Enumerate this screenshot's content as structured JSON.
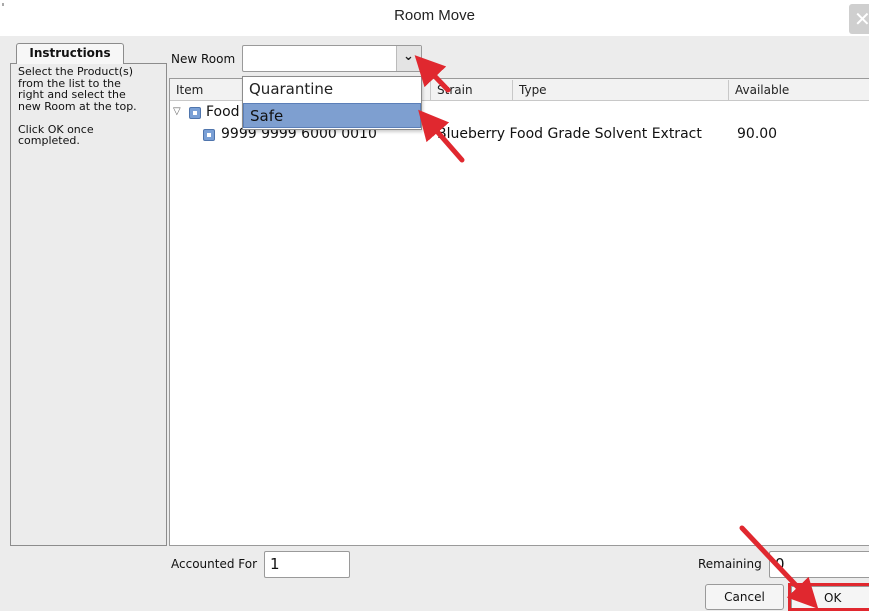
{
  "window": {
    "title": "Room Move"
  },
  "instructions": {
    "tab_label": "Instructions",
    "text": "Select the Product(s)\nfrom the list to the\nright and select the\nnew Room at the top.\n\nClick OK once\ncompleted."
  },
  "new_room": {
    "label": "New Room",
    "value": ""
  },
  "dropdown": {
    "options": [
      "Quarantine",
      "Safe"
    ],
    "highlighted": "Safe"
  },
  "table": {
    "columns": [
      "Item",
      "Strain",
      "Type",
      "Available"
    ],
    "group_label": "Food",
    "row": {
      "item": "9999 9999 6000 0010",
      "strain_type": "Blueberry Food Grade Solvent Extract",
      "available": "90.00"
    }
  },
  "footer": {
    "accounted_for_label": "Accounted For",
    "accounted_for_value": "1",
    "remaining_label": "Remaining",
    "remaining_value": "0",
    "cancel_label": "Cancel",
    "ok_label": "OK"
  },
  "colors": {
    "annotation_arrow": "#e0282f",
    "selection": "#7e9fd0"
  },
  "icons": [
    "close-icon",
    "chevron-down-icon",
    "expand-triangle-icon",
    "checkbox-icon"
  ]
}
